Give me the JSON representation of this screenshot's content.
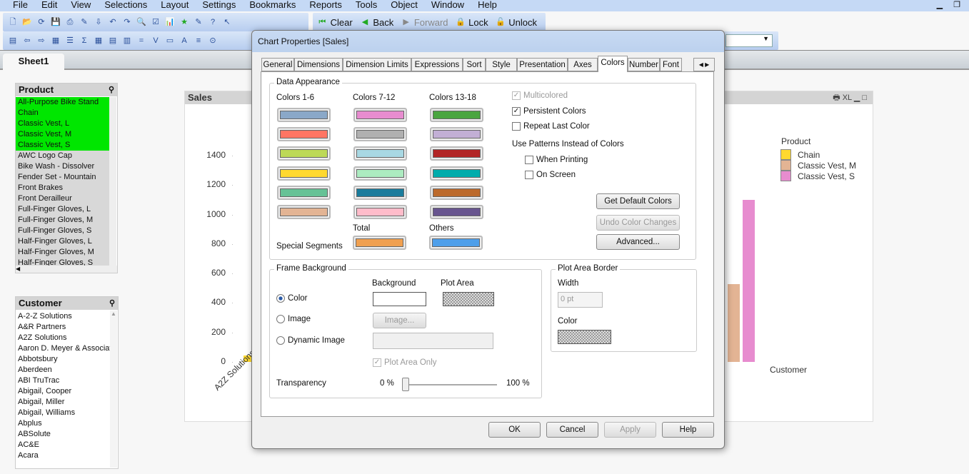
{
  "menu": [
    "File",
    "Edit",
    "View",
    "Selections",
    "Layout",
    "Settings",
    "Bookmarks",
    "Reports",
    "Tools",
    "Object",
    "Window",
    "Help"
  ],
  "toolbar": {
    "clear": "Clear",
    "back": "Back",
    "forward": "Forward",
    "lock": "Lock",
    "unlock": "Unlock"
  },
  "sheet_tab": "Sheet1",
  "product_list": {
    "title": "Product",
    "items": [
      {
        "label": "All-Purpose Bike Stand",
        "state": "selected"
      },
      {
        "label": "Chain",
        "state": "selected"
      },
      {
        "label": "Classic Vest, L",
        "state": "selected"
      },
      {
        "label": "Classic Vest, M",
        "state": "selected"
      },
      {
        "label": "Classic Vest, S",
        "state": "selected"
      },
      {
        "label": "AWC Logo Cap",
        "state": "excluded"
      },
      {
        "label": "Bike Wash - Dissolver",
        "state": "excluded"
      },
      {
        "label": "Fender Set - Mountain",
        "state": "excluded"
      },
      {
        "label": "Front Brakes",
        "state": "excluded"
      },
      {
        "label": "Front Derailleur",
        "state": "excluded"
      },
      {
        "label": "Full-Finger Gloves, L",
        "state": "excluded"
      },
      {
        "label": "Full-Finger Gloves, M",
        "state": "excluded"
      },
      {
        "label": "Full-Finger Gloves, S",
        "state": "excluded"
      },
      {
        "label": "Half-Finger Gloves, L",
        "state": "excluded"
      },
      {
        "label": "Half-Finger Gloves, M",
        "state": "excluded"
      },
      {
        "label": "Half-Finger Gloves, S",
        "state": "excluded"
      }
    ]
  },
  "customer_list": {
    "title": "Customer",
    "items": [
      "A-2-Z Solutions",
      "A&R Partners",
      "A2Z Solutions",
      "Aaron D. Meyer & Associat",
      "Abbotsbury",
      "Aberdeen",
      "ABI TruTrac",
      "Abigail, Cooper",
      "Abigail, Miller",
      "Abigail, Williams",
      "Abplus",
      "ABSolute",
      "AC&E",
      "Acara"
    ]
  },
  "chart": {
    "title": "Sales",
    "caption_buttons": [
      "XL"
    ]
  },
  "chart_data": {
    "type": "bar",
    "title": "Sales",
    "xlabel": "Customer",
    "ylabel": "",
    "yticks": [
      0,
      200,
      400,
      600,
      800,
      1000,
      1200,
      1400
    ],
    "ylim": [
      0,
      1500
    ],
    "categories": [
      "A2Z Solutions",
      ""
    ],
    "legend": {
      "title": "Product",
      "position": "top-right"
    },
    "series": [
      {
        "name": "Chain",
        "color": "#ffd92f",
        "values": [
          45,
          0
        ]
      },
      {
        "name": "Classic Vest, M",
        "color": "#e3b494",
        "values": [
          0,
          530
        ]
      },
      {
        "name": "Classic Vest, S",
        "color": "#e78ccf",
        "values": [
          0,
          1100
        ]
      }
    ]
  },
  "dialog": {
    "title": "Chart Properties [Sales]",
    "tabs": [
      "General",
      "Dimensions",
      "Dimension Limits",
      "Expressions",
      "Sort",
      "Style",
      "Presentation",
      "Axes",
      "Colors",
      "Number",
      "Font"
    ],
    "active_tab": "Colors",
    "data_appearance": {
      "label": "Data Appearance",
      "col_headers": [
        "Colors 1-6",
        "Colors 7-12",
        "Colors 13-18"
      ],
      "colors": [
        [
          "#8aa8c8",
          "#ff7563",
          "#bdd957",
          "#ffd92f",
          "#66c296",
          "#e3b494"
        ],
        [
          "#e78ccf",
          "#b0b0b0",
          "#a8d8e3",
          "#acebc0",
          "#1a7c9c",
          "#ffbcca"
        ],
        [
          "#4aa540",
          "#c2afd5",
          "#b22526",
          "#00acac",
          "#bc6a2c",
          "#68558f"
        ]
      ],
      "special_segments": "Special Segments",
      "total_label": "Total",
      "total_color": "#f0a050",
      "others_label": "Others",
      "others_color": "#4e9fea",
      "multicolored": {
        "label": "Multicolored",
        "checked": true,
        "disabled": true
      },
      "persistent": {
        "label": "Persistent Colors",
        "checked": true
      },
      "repeat_last": {
        "label": "Repeat Last Color",
        "checked": false
      },
      "patterns_label": "Use Patterns Instead of Colors",
      "when_printing": {
        "label": "When Printing",
        "checked": false
      },
      "on_screen": {
        "label": "On Screen",
        "checked": false
      },
      "get_default": "Get Default Colors",
      "undo": "Undo Color Changes",
      "advanced": "Advanced..."
    },
    "frame_background": {
      "label": "Frame Background",
      "background": "Background",
      "plot_area": "Plot Area",
      "color": "Color",
      "image": "Image",
      "dynamic_image": "Dynamic Image",
      "image_button": "Image...",
      "plot_area_only": "Plot Area Only",
      "transparency": "Transparency",
      "t_min": "0 %",
      "t_max": "100 %",
      "transparency_value": 0,
      "selected": "Color"
    },
    "plot_area_border": {
      "label": "Plot Area Border",
      "width_label": "Width",
      "width_value": "0 pt",
      "color_label": "Color"
    },
    "buttons": {
      "ok": "OK",
      "cancel": "Cancel",
      "apply": "Apply",
      "help": "Help"
    }
  }
}
